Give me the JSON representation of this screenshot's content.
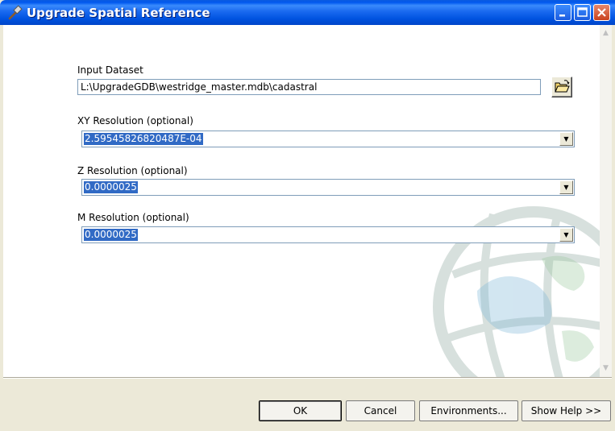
{
  "window": {
    "title": "Upgrade Spatial Reference"
  },
  "fields": {
    "input_dataset": {
      "label": "Input Dataset",
      "value": "L:\\UpgradeGDB\\westridge_master.mdb\\cadastral"
    },
    "xy_resolution": {
      "label": "XY Resolution (optional)",
      "value": "2.59545826820487E-04"
    },
    "z_resolution": {
      "label": "Z Resolution (optional)",
      "value": "0.0000025"
    },
    "m_resolution": {
      "label": "M Resolution (optional)",
      "value": "0.0000025"
    }
  },
  "buttons": {
    "ok": "OK",
    "cancel": "Cancel",
    "environments": "Environments...",
    "show_help": "Show Help >>"
  },
  "colors": {
    "titlebar": "#0058EE",
    "selection": "#316AC5",
    "dialog_bg": "#ECE9D8"
  }
}
